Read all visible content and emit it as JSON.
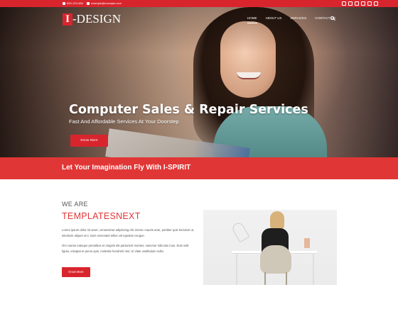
{
  "topbar": {
    "phone": "800-123-456",
    "email": "example@example.com",
    "social_icons": [
      "twitter-icon",
      "facebook-icon",
      "linkedin-icon",
      "instagram-icon",
      "youtube-icon",
      "flickr-icon"
    ]
  },
  "header": {
    "logo_mark": "I",
    "logo_text": "-DESIGN",
    "nav": [
      "HOME",
      "ABOUT US",
      "SERVICES",
      "CONTACT US"
    ],
    "active_nav": "HOME"
  },
  "hero": {
    "title": "Computer Sales & Repair Services",
    "subtitle": "Fast And Affordable Services At Your Doorstep",
    "button": "Know More"
  },
  "banner": {
    "text": "Let Your Imagination Fly With I-SPIRIT"
  },
  "about": {
    "kicker": "WE ARE",
    "heading": "TEMPLATESNEXT",
    "paragraph1": "Lorem ipsum dolor sit amet, consectetur adipiscing elit. Donec mauris ante, porttitor quis tincidunt ut, interdum aliquet orci. Duis venenatis tellus vel egestas congue.",
    "paragraph2": "Orci varius natoque penatibus et magnis dis parturient montes, nascetur ridiculus mus. Duis velit ligula, volutpat et purus quis, molestie hendrerit nisi. Ut vitae vestibulum nulla.",
    "button": "Know More"
  },
  "colors": {
    "accent": "#d8252d",
    "banner": "#e13636",
    "heading": "#e13636"
  }
}
